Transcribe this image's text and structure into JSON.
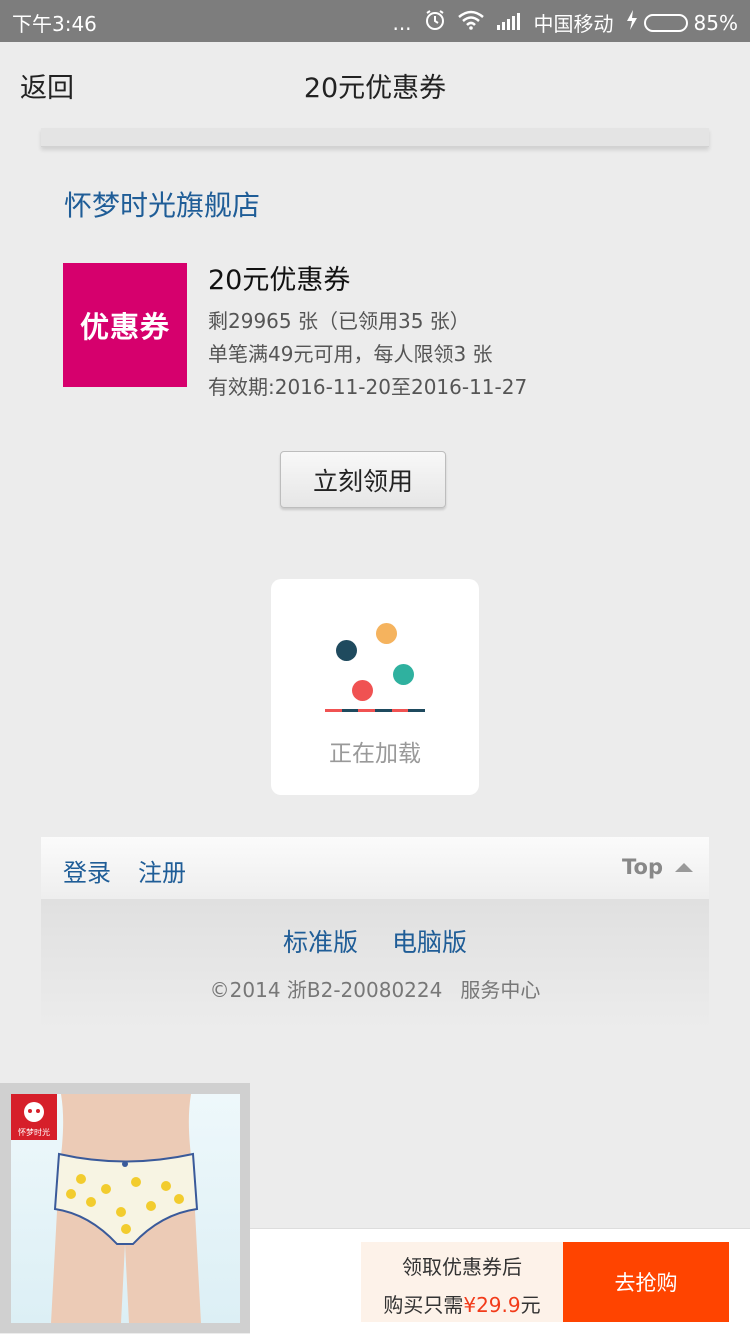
{
  "status_bar": {
    "time": "下午3:46",
    "dots": "...",
    "carrier": "中国移动",
    "battery": "85%",
    "battery_level": 0.85
  },
  "header": {
    "back_label": "返回",
    "title": "20元优惠券"
  },
  "store": {
    "name": "怀梦时光旗舰店"
  },
  "coupon": {
    "image_label": "优惠券",
    "title": "20元优惠券",
    "remaining": "剩29965 张（已领用35 张）",
    "condition": "单笔满49元可用，每人限领3 张",
    "validity": "有效期:2016-11-20至2016-11-27",
    "claim_button": "立刻领用",
    "brand_color": "#d6006d"
  },
  "loading": {
    "text": "正在加载",
    "dot_colors": [
      "#1f4a5e",
      "#f5b35e",
      "#2fb19f",
      "#f05252"
    ]
  },
  "footer": {
    "login": "登录",
    "register": "注册",
    "top": "Top",
    "standard_version": "标准版",
    "pc_version": "电脑版",
    "copyright": "©2014 浙B2-20080224",
    "service": "服务中心"
  },
  "promo": {
    "logo_text": "怀梦时光",
    "line1": "领取优惠券后",
    "line2_prefix": "购买只需",
    "price": "¥29.9",
    "line2_suffix": "元",
    "buy_button": "去抢购",
    "accent_color": "#ff4400"
  }
}
